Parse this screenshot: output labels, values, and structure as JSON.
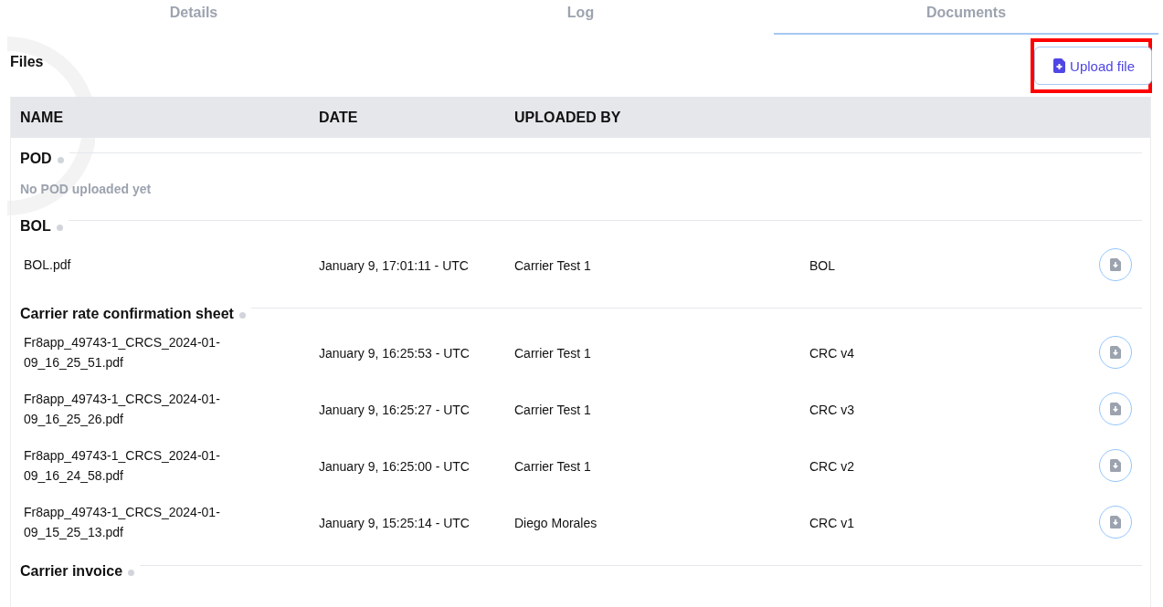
{
  "tabs": [
    {
      "label": "Details",
      "selected": false
    },
    {
      "label": "Log",
      "selected": false
    },
    {
      "label": "Documents",
      "selected": true
    }
  ],
  "files_title": "Files",
  "upload_button": {
    "label": "Upload file",
    "highlighted": true
  },
  "table": {
    "columns": [
      "NAME",
      "DATE",
      "UPLOADED BY"
    ],
    "groups": [
      {
        "title": "POD",
        "empty_message": "No POD uploaded yet"
      },
      {
        "title": "BOL",
        "rows": [
          {
            "name": "BOL.pdf",
            "date": "January 9, 17:01:11 - UTC",
            "uploaded_by": "Carrier Test 1",
            "type": "BOL"
          }
        ]
      },
      {
        "title": "Carrier rate confirmation sheet",
        "rows": [
          {
            "name": "Fr8app_49743-1_CRCS_2024-01-09_16_25_51.pdf",
            "date": "January 9, 16:25:53 - UTC",
            "uploaded_by": "Carrier Test 1",
            "type": "CRC v4"
          },
          {
            "name": "Fr8app_49743-1_CRCS_2024-01-09_16_25_26.pdf",
            "date": "January 9, 16:25:27 - UTC",
            "uploaded_by": "Carrier Test 1",
            "type": "CRC v3"
          },
          {
            "name": "Fr8app_49743-1_CRCS_2024-01-09_16_24_58.pdf",
            "date": "January 9, 16:25:00 - UTC",
            "uploaded_by": "Carrier Test 1",
            "type": "CRC v2"
          },
          {
            "name": "Fr8app_49743-1_CRCS_2024-01-09_15_25_13.pdf",
            "date": "January 9, 15:25:14 - UTC",
            "uploaded_by": "Diego Morales",
            "type": "CRC v1"
          }
        ]
      },
      {
        "title": "Carrier invoice"
      }
    ]
  }
}
